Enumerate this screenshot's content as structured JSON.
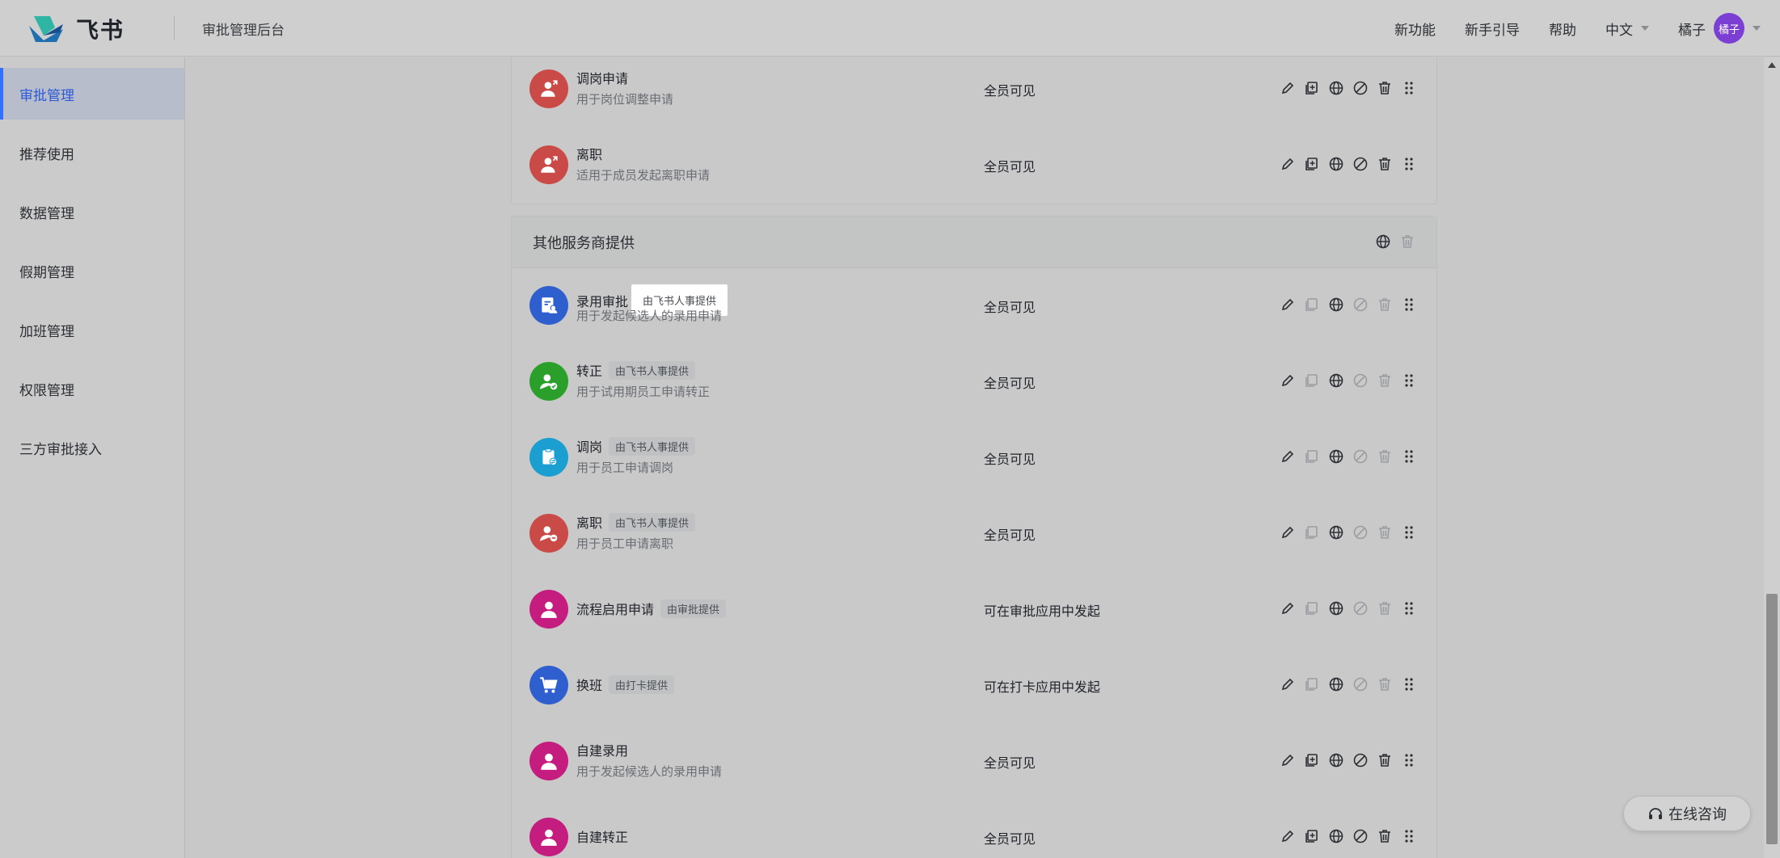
{
  "topbar": {
    "brand": "飞书",
    "admin_title": "审批管理后台",
    "nav": [
      "新功能",
      "新手引导",
      "帮助"
    ],
    "language": "中文",
    "user_name": "橘子",
    "avatar_text": "橘子"
  },
  "sidebar": {
    "items": [
      {
        "label": "审批管理",
        "active": true
      },
      {
        "label": "推荐使用",
        "active": false
      },
      {
        "label": "数据管理",
        "active": false
      },
      {
        "label": "假期管理",
        "active": false
      },
      {
        "label": "加班管理",
        "active": false
      },
      {
        "label": "权限管理",
        "active": false
      },
      {
        "label": "三方审批接入",
        "active": false
      }
    ]
  },
  "group_top": {
    "rows": [
      {
        "name": "调岗申请",
        "desc": "用于岗位调整申请",
        "visibility": "全员可见",
        "icon_color": "#c94a47",
        "icon": "person-arrow-icon"
      },
      {
        "name": "离职",
        "desc": "适用于成员发起离职申请",
        "visibility": "全员可见",
        "icon_color": "#c94a47",
        "icon": "person-arrow-icon"
      }
    ]
  },
  "group_other": {
    "title": "其他服务商提供",
    "rows": [
      {
        "name": "录用审批",
        "tag": "由飞书人事提供",
        "desc": "用于发起候选人的录用申请",
        "visibility": "全员可见",
        "icon_color": "#2f5fcf",
        "icon": "document-person-icon",
        "highlight": true
      },
      {
        "name": "转正",
        "tag": "由飞书人事提供",
        "desc": "用于试用期员工申请转正",
        "visibility": "全员可见",
        "icon_color": "#2aa02a",
        "icon": "person-check-icon"
      },
      {
        "name": "调岗",
        "tag": "由飞书人事提供",
        "desc": "用于员工申请调岗",
        "visibility": "全员可见",
        "icon_color": "#1b9fd1",
        "icon": "clipboard-swap-icon"
      },
      {
        "name": "离职",
        "tag": "由飞书人事提供",
        "desc": "用于员工申请离职",
        "visibility": "全员可见",
        "icon_color": "#c94a47",
        "icon": "person-minus-icon"
      },
      {
        "name": "流程启用申请",
        "tag": "由审批提供",
        "desc": "",
        "visibility": "可在审批应用中发起",
        "icon_color": "#c41d7f",
        "icon": "person-icon"
      },
      {
        "name": "换班",
        "tag": "由打卡提供",
        "desc": "",
        "visibility": "可在打卡应用中发起",
        "icon_color": "#2f5fcf",
        "icon": "cart-icon"
      },
      {
        "name": "自建录用",
        "tag": "",
        "desc": "用于发起候选人的录用申请",
        "visibility": "全员可见",
        "icon_color": "#c41d7f",
        "icon": "person-icon"
      },
      {
        "name": "自建转正",
        "tag": "",
        "desc": "",
        "visibility": "全员可见",
        "icon_color": "#c41d7f",
        "icon": "person-icon"
      }
    ]
  },
  "consult": {
    "label": "在线咨询"
  },
  "colors": {
    "accent": "#3370ff",
    "active_text": "#2c59d6"
  }
}
